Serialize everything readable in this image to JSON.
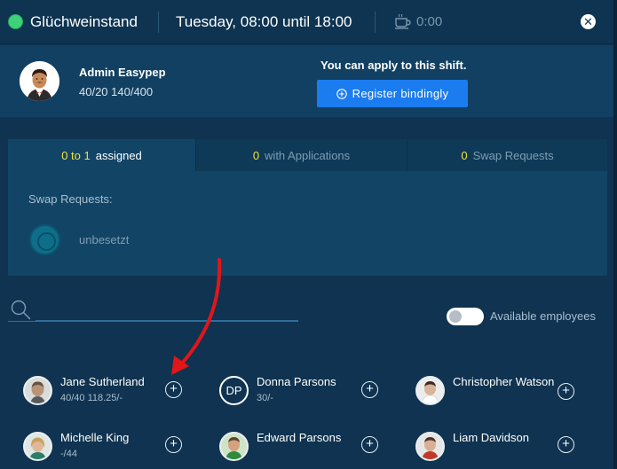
{
  "topbar": {
    "shift_name": "Glüchweinstand",
    "shift_time": "Tuesday, 08:00 until 18:00",
    "break_time": "0:00",
    "status_color": "#3fd07a",
    "icons": {
      "break": "coffee-cup-icon",
      "close": "close-icon"
    }
  },
  "user": {
    "name": "Admin Easypep",
    "stats": "40/20 140/400",
    "apply_text": "You can apply to this shift.",
    "register_label": "Register bindingly"
  },
  "tabs": [
    {
      "count": "0 to 1",
      "label": "assigned",
      "active": true
    },
    {
      "count": "0",
      "label": "with Applications",
      "active": false
    },
    {
      "count": "0",
      "label": "Swap Requests",
      "active": false
    }
  ],
  "swap": {
    "title": "Swap Requests:",
    "unassigned_label": "unbesetzt"
  },
  "search": {
    "value": "",
    "placeholder": ""
  },
  "filter": {
    "label": "Available employees",
    "enabled": false
  },
  "employees": [
    {
      "name": "Jane Sutherland",
      "sub": "40/40 118.25/-",
      "initials": ""
    },
    {
      "name": "Donna Parsons",
      "sub": "30/-",
      "initials": "DP"
    },
    {
      "name": "Christopher Watson",
      "sub": "",
      "initials": ""
    },
    {
      "name": "Michelle King",
      "sub": "-/44",
      "initials": ""
    },
    {
      "name": "Edward Parsons",
      "sub": "",
      "initials": ""
    },
    {
      "name": "Liam Davidson",
      "sub": "",
      "initials": ""
    }
  ],
  "colors": {
    "background": "#0f3350",
    "panel": "#124466",
    "accent_button": "#1b7cf0",
    "count_highlight": "#f1e23a",
    "annotation_arrow": "#e0161b"
  }
}
